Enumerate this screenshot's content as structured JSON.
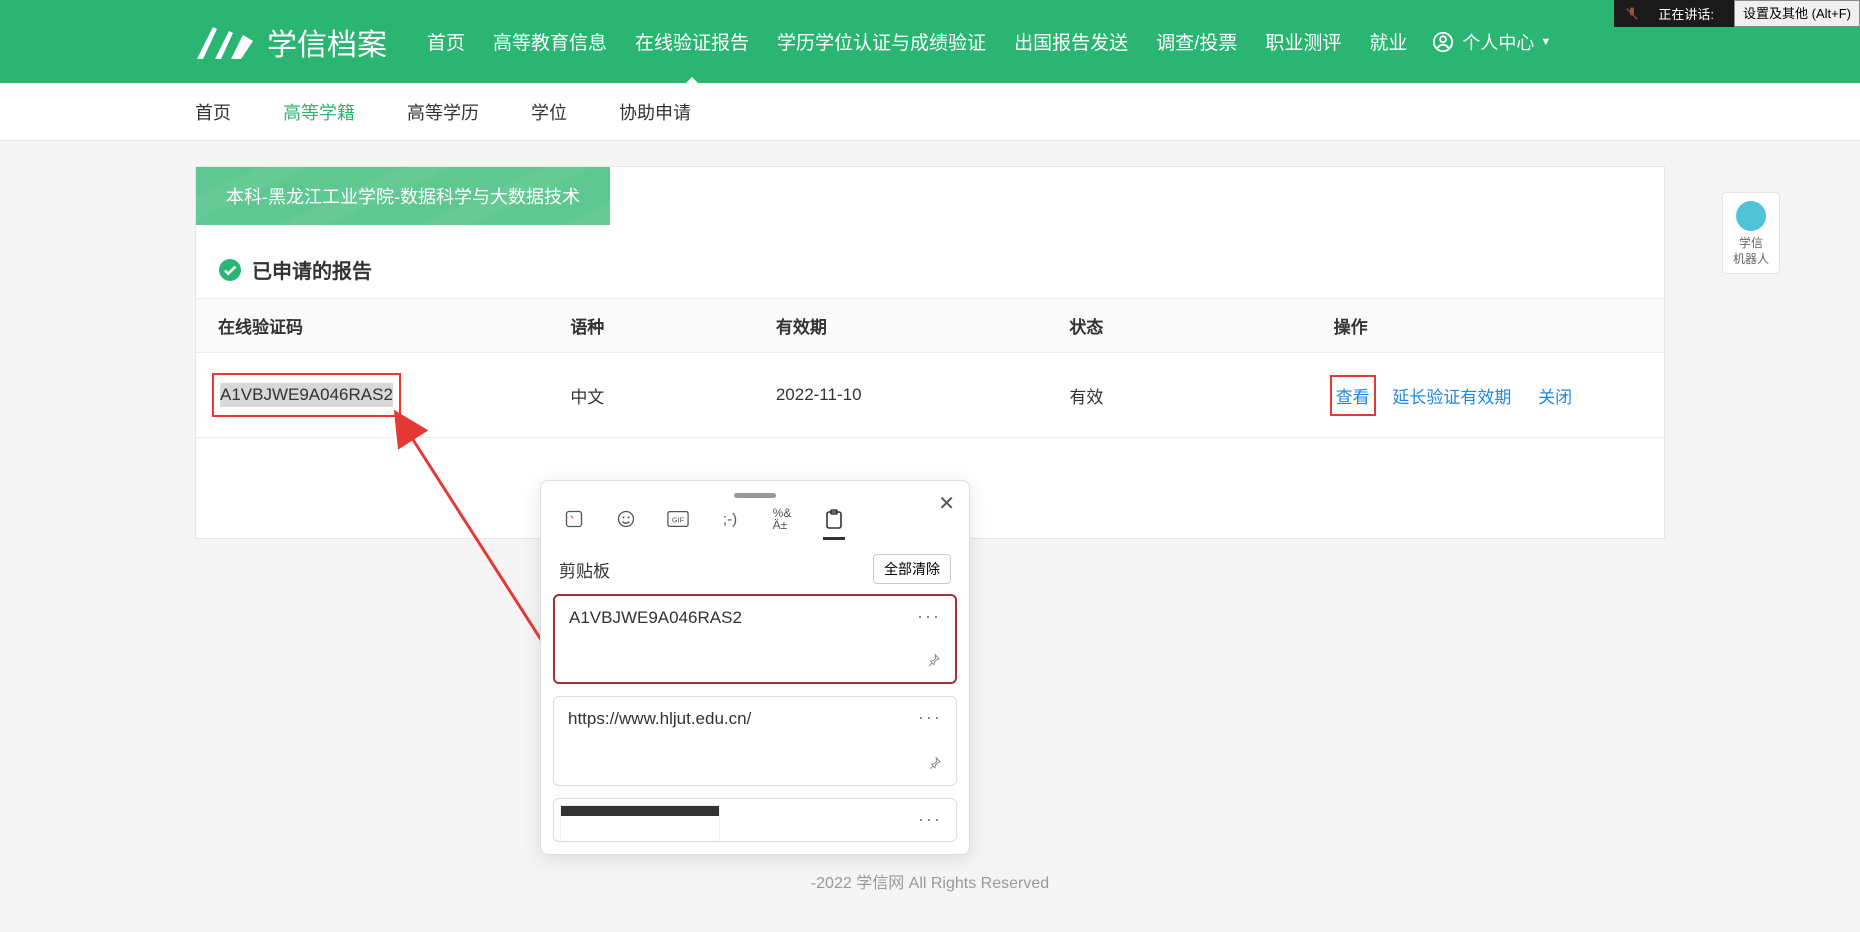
{
  "overlay": {
    "speaking_label": "正在讲话:",
    "settings_tooltip": "设置及其他 (Alt+F)"
  },
  "header": {
    "logo_text": "学信档案",
    "nav": [
      "首页",
      "高等教育信息",
      "在线验证报告",
      "学历学位认证与成绩验证",
      "出国报告发送",
      "调查/投票",
      "职业测评",
      "就业"
    ],
    "active_nav_index": 2,
    "user_center": "个人中心"
  },
  "sub_nav": {
    "items": [
      "首页",
      "高等学籍",
      "高等学历",
      "学位",
      "协助申请"
    ],
    "active_index": 1
  },
  "content": {
    "green_tab": "本科-黑龙江工业学院-数据科学与大数据技术",
    "section_title": "已申请的报告",
    "columns": [
      "在线验证码",
      "语种",
      "有效期",
      "状态",
      "操作"
    ],
    "row": {
      "code": "A1VBJWE9A046RAS2",
      "language": "中文",
      "expiry": "2022-11-10",
      "status": "有效",
      "actions": [
        "查看",
        "延长验证有效期",
        "关闭"
      ]
    }
  },
  "robot": {
    "line1": "学信",
    "line2": "机器人"
  },
  "footer": {
    "text": "-2022 学信网 All Rights Reserved"
  },
  "clipboard": {
    "title": "剪贴板",
    "clear_all": "全部清除",
    "items": [
      {
        "text": "A1VBJWE9A046RAS2"
      },
      {
        "text": "https://www.hljut.edu.cn/"
      }
    ]
  }
}
